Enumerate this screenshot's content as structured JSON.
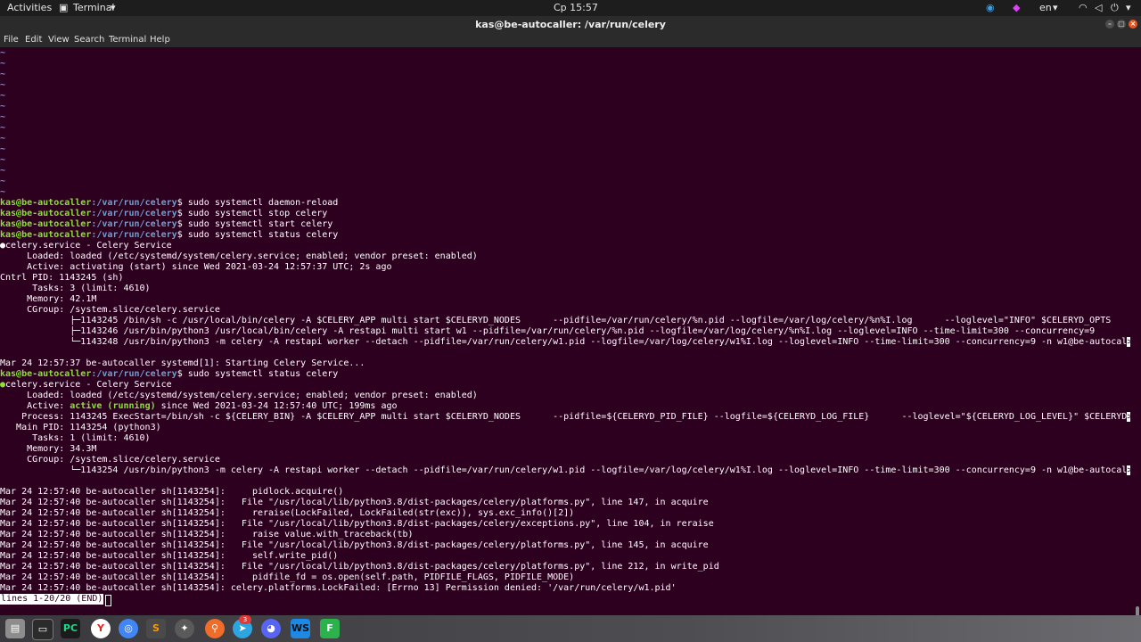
{
  "topbar": {
    "activities": "Activities",
    "app_menu": "Terminal",
    "clock": "Ср 15:57",
    "lang": "en"
  },
  "window": {
    "title": "kas@be-autocaller: /var/run/celery"
  },
  "menu": [
    "File",
    "Edit",
    "View",
    "Search",
    "Terminal",
    "Help"
  ],
  "terminal": {
    "user_host": "kas@be-autocaller",
    "path": ":/var/run/celery",
    "prompt_suffix": "$ ",
    "tilde_lines": [
      "~",
      "~",
      "~",
      "~",
      "~",
      "~",
      "~",
      "~",
      "~",
      "~",
      "~",
      "~",
      "~",
      "~"
    ],
    "cmd1": "sudo systemctl daemon-reload",
    "cmd2": "sudo systemctl stop celery",
    "cmd3": "sudo systemctl start celery",
    "cmd4": "sudo systemctl status celery",
    "s1_head": "celery.service - Celery Service",
    "s1_loaded": "     Loaded: loaded (/etc/systemd/system/celery.service; enabled; vendor preset: enabled)",
    "s1_active": "     Active: activating (start) since Wed 2021-03-24 12:57:37 UTC; 2s ago",
    "s1_cntrl": "Cntrl PID: 1143245 (sh)",
    "s1_tasks": "      Tasks: 3 (limit: 4610)",
    "s1_memory": "     Memory: 42.1M",
    "s1_cgroup": "     CGroup: /system.slice/celery.service",
    "s1_p1": "             ├─1143245 /bin/sh -c /usr/local/bin/celery -A $CELERY_APP multi start $CELERYD_NODES      --pidfile=/var/run/celery/%n.pid --logfile=/var/log/celery/%n%I.log      --loglevel=\"INFO\" $CELERYD_OPTS",
    "s1_p2": "             ├─1143246 /usr/bin/python3 /usr/local/bin/celery -A restapi multi start w1 --pidfile=/var/run/celery/%n.pid --logfile=/var/log/celery/%n%I.log --loglevel=INFO --time-limit=300 --concurrency=9",
    "s1_p3": "             └─1143248 /usr/bin/python3 -m celery -A restapi worker --detach --pidfile=/var/run/celery/w1.pid --logfile=/var/log/celery/w1%I.log --loglevel=INFO --time-limit=300 --concurrency=9 -n w1@be-autocal",
    "log0": "Mar 24 12:57:37 be-autocaller systemd[1]: Starting Celery Service...",
    "cmd5": "sudo systemctl status celery",
    "s2_head": "celery.service - Celery Service",
    "s2_loaded": "     Loaded: loaded (/etc/systemd/system/celery.service; enabled; vendor preset: enabled)",
    "s2_active_pre": "     Active: ",
    "s2_active_state": "active (running)",
    "s2_active_post": " since Wed 2021-03-24 12:57:40 UTC; 199ms ago",
    "s2_process": "    Process: 1143245 ExecStart=/bin/sh -c ${CELERY_BIN} -A $CELERY_APP multi start $CELERYD_NODES      --pidfile=${CELERYD_PID_FILE} --logfile=${CELERYD_LOG_FILE}      --loglevel=\"${CELERYD_LOG_LEVEL}\" $CELERYD",
    "s2_mainpid": "   Main PID: 1143254 (python3)",
    "s2_tasks": "      Tasks: 1 (limit: 4610)",
    "s2_memory": "     Memory: 34.3M",
    "s2_cgroup": "     CGroup: /system.slice/celery.service",
    "s2_p1": "             └─1143254 /usr/bin/python3 -m celery -A restapi worker --detach --pidfile=/var/run/celery/w1.pid --logfile=/var/log/celery/w1%I.log --loglevel=INFO --time-limit=300 --concurrency=9 -n w1@be-autocal",
    "log1": "Mar 24 12:57:40 be-autocaller sh[1143254]:     pidlock.acquire()",
    "log2": "Mar 24 12:57:40 be-autocaller sh[1143254]:   File \"/usr/local/lib/python3.8/dist-packages/celery/platforms.py\", line 147, in acquire",
    "log3": "Mar 24 12:57:40 be-autocaller sh[1143254]:     reraise(LockFailed, LockFailed(str(exc)), sys.exc_info()[2])",
    "log4": "Mar 24 12:57:40 be-autocaller sh[1143254]:   File \"/usr/local/lib/python3.8/dist-packages/celery/exceptions.py\", line 104, in reraise",
    "log5": "Mar 24 12:57:40 be-autocaller sh[1143254]:     raise value.with_traceback(tb)",
    "log6": "Mar 24 12:57:40 be-autocaller sh[1143254]:   File \"/usr/local/lib/python3.8/dist-packages/celery/platforms.py\", line 145, in acquire",
    "log7": "Mar 24 12:57:40 be-autocaller sh[1143254]:     self.write_pid()",
    "log8": "Mar 24 12:57:40 be-autocaller sh[1143254]:   File \"/usr/local/lib/python3.8/dist-packages/celery/platforms.py\", line 212, in write_pid",
    "log9": "Mar 24 12:57:40 be-autocaller sh[1143254]:     pidfile_fd = os.open(self.path, PIDFILE_FLAGS, PIDFILE_MODE)",
    "log10": "Mar 24 12:57:40 be-autocaller sh[1143254]: celery.platforms.LockFailed: [Errno 13] Permission denied: '/var/run/celery/w1.pid'",
    "status": "lines 1-20/20 (END)",
    "trunc": ">",
    "bullet": "●"
  },
  "taskbar": {
    "apps": [
      "files",
      "terminal",
      "pycharm",
      "yandex",
      "chrome",
      "sublime",
      "postman",
      "gitkraken",
      "telegram",
      "discord",
      "webstorm",
      "feedly"
    ],
    "telegram_badge": "3"
  },
  "colors": {
    "background": "#2c001e",
    "user_host": "#8ae234",
    "path": "#729fcf",
    "running": "#8ae234"
  }
}
